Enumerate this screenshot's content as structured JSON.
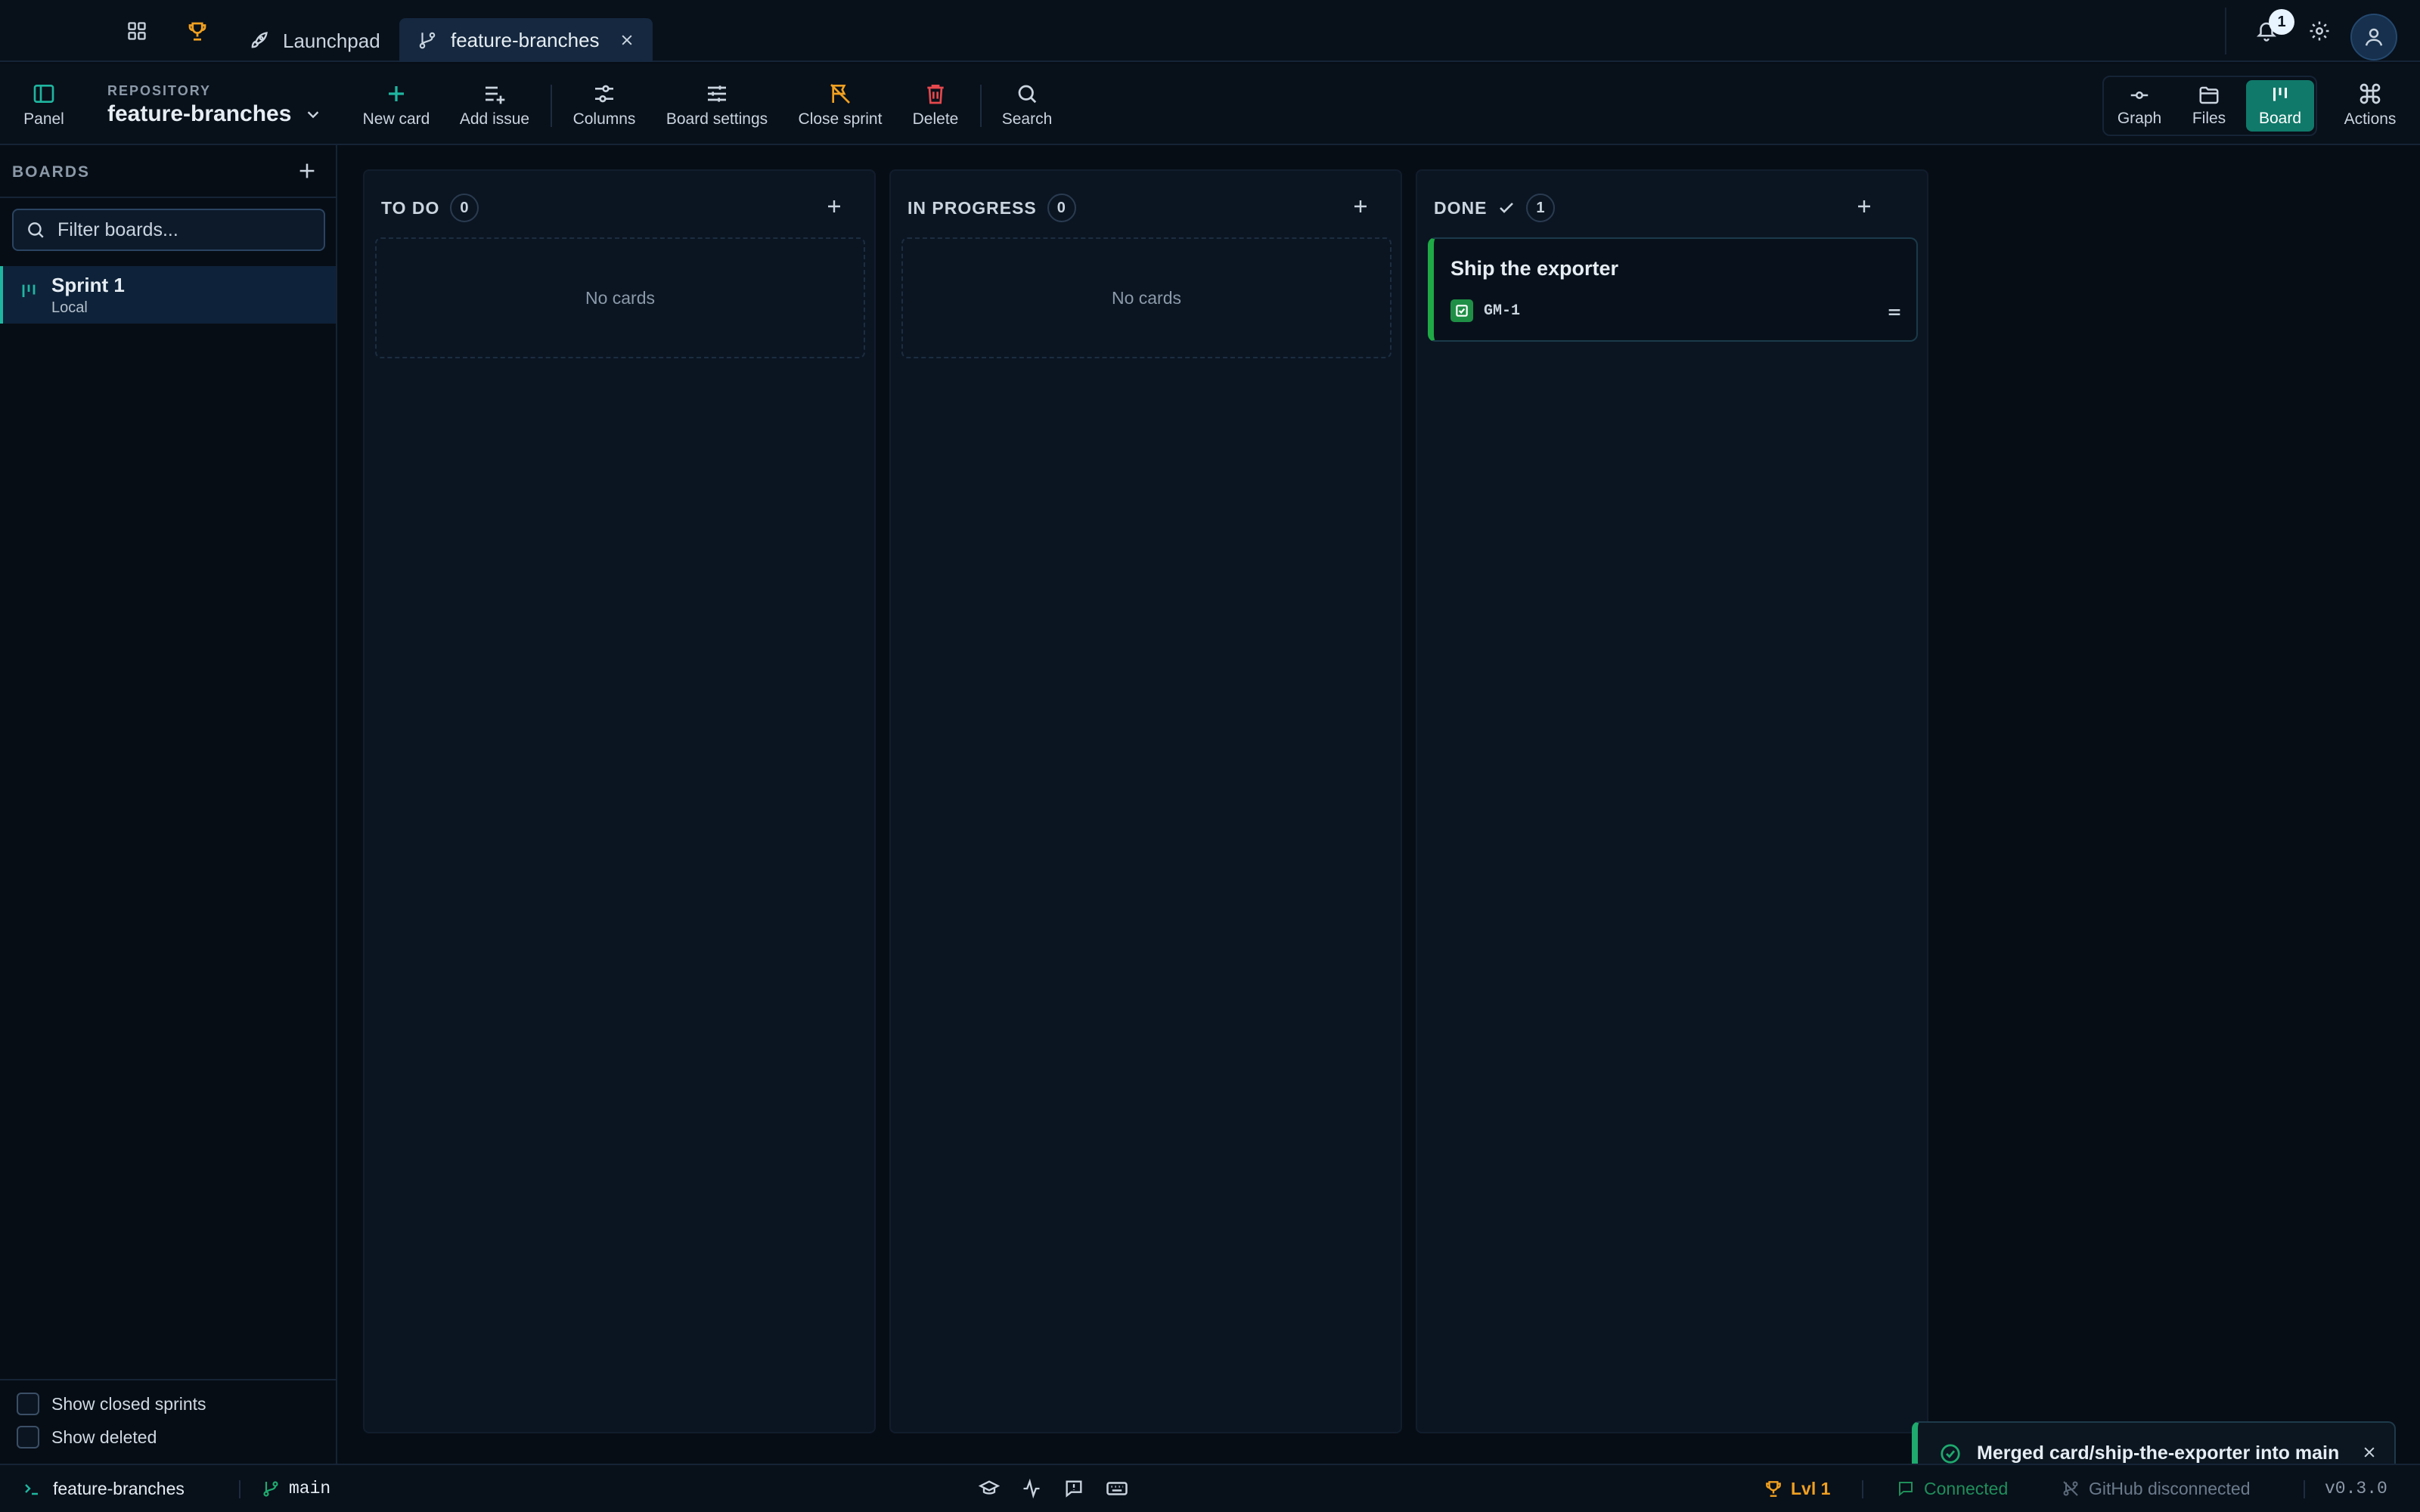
{
  "tabs": {
    "items": [
      {
        "label": "Launchpad",
        "icon": "rocket-icon"
      },
      {
        "label": "feature-branches",
        "icon": "branch-icon",
        "active": true
      }
    ],
    "notification_count": "1"
  },
  "toolbar": {
    "panel_label": "Panel",
    "repository_kicker": "REPOSITORY",
    "repository_name": "feature-branches",
    "new_card_label": "New card",
    "add_issue_label": "Add issue",
    "columns_label": "Columns",
    "board_settings_label": "Board settings",
    "close_sprint_label": "Close sprint",
    "delete_label": "Delete",
    "search_label": "Search",
    "views": {
      "graph_label": "Graph",
      "files_label": "Files",
      "board_label": "Board",
      "active": "Board"
    },
    "actions_label": "Actions"
  },
  "sidebar": {
    "heading": "BOARDS",
    "filter_placeholder": "Filter boards...",
    "boards": [
      {
        "name": "Sprint 1",
        "subtitle": "Local",
        "selected": true
      }
    ],
    "show_closed_label": "Show closed sprints",
    "show_deleted_label": "Show deleted"
  },
  "board": {
    "columns": [
      {
        "title": "TO DO",
        "count": "0",
        "empty_text": "No cards",
        "cards": []
      },
      {
        "title": "IN PROGRESS",
        "count": "0",
        "empty_text": "No cards",
        "cards": []
      },
      {
        "title": "DONE",
        "count": "1",
        "cards": [
          {
            "title": "Ship the exporter",
            "key": "GM-1"
          }
        ]
      }
    ]
  },
  "toast": {
    "message": "Merged card/ship-the-exporter into main"
  },
  "statusbar": {
    "repo": "feature-branches",
    "branch": "main",
    "level": "Lvl 1",
    "connection": "Connected",
    "github": "GitHub disconnected",
    "version": "v0.3.0"
  },
  "colors": {
    "accent": "#1fb6a0",
    "done_green": "#1faa45",
    "trophy": "#f0a020",
    "danger": "#e5484d"
  }
}
